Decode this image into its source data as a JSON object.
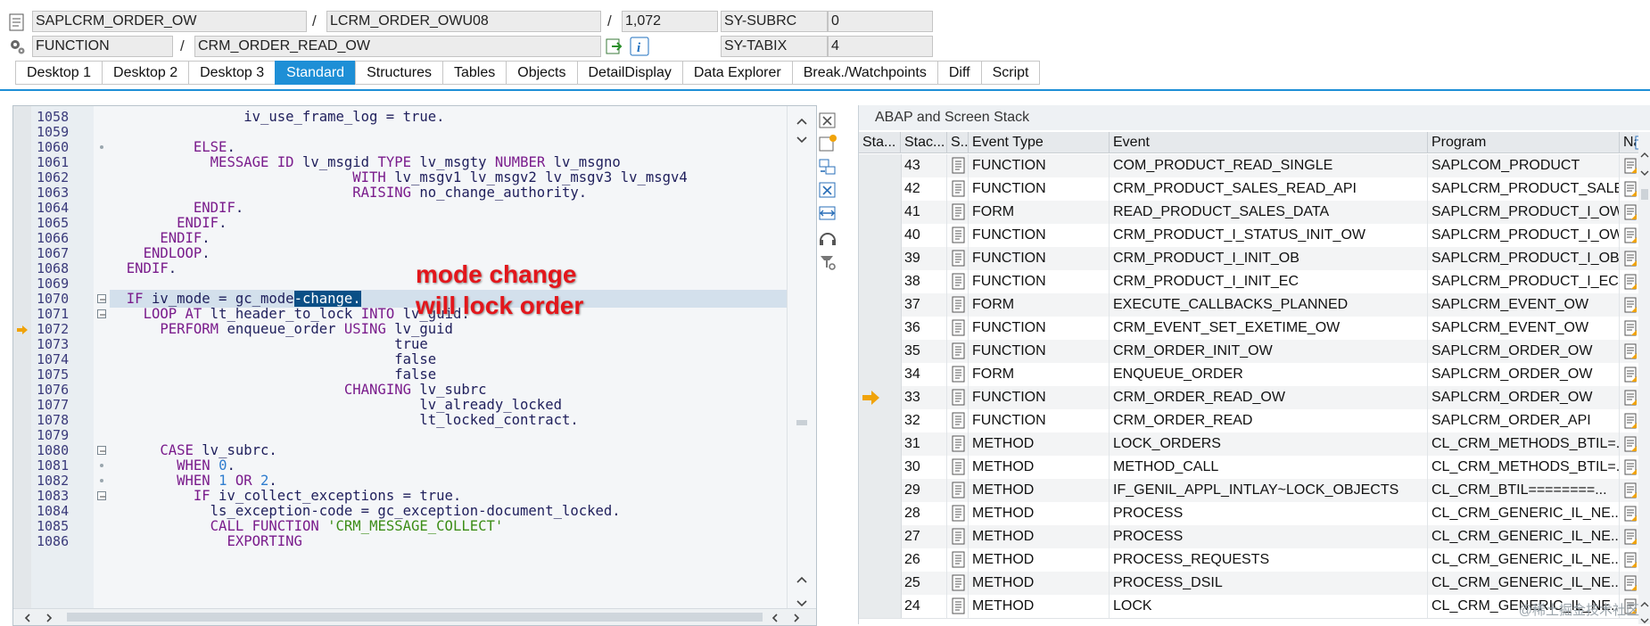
{
  "header": {
    "program": "SAPLCRM_ORDER_OW",
    "include": "LCRM_ORDER_OWU08",
    "line": "1,072",
    "event_type": "FUNCTION",
    "event_name": "CRM_ORDER_READ_OW",
    "sysvar1_name": "SY-SUBRC",
    "sysvar1_value": "0",
    "sysvar2_name": "SY-TABIX",
    "sysvar2_value": "4",
    "slash": "/"
  },
  "tabs": [
    {
      "label": "Desktop 1"
    },
    {
      "label": "Desktop 2"
    },
    {
      "label": "Desktop 3"
    },
    {
      "label": "Standard",
      "active": true
    },
    {
      "label": "Structures"
    },
    {
      "label": "Tables"
    },
    {
      "label": "Objects"
    },
    {
      "label": "DetailDisplay"
    },
    {
      "label": "Data Explorer"
    },
    {
      "label": "Break./Watchpoints"
    },
    {
      "label": "Diff"
    },
    {
      "label": "Script"
    }
  ],
  "annotation": {
    "line1": "mode change",
    "line2": "will lock order"
  },
  "code": {
    "current_line": "1072",
    "highlight_line": "1070",
    "lines": [
      {
        "n": "1058",
        "text": "                iv_use_frame_log = true."
      },
      {
        "n": "1059",
        "text": ""
      },
      {
        "n": "1060",
        "text": "          ELSE."
      },
      {
        "n": "1061",
        "text": "            MESSAGE ID lv_msgid TYPE lv_msgty NUMBER lv_msgno"
      },
      {
        "n": "1062",
        "text": "                             WITH lv_msgv1 lv_msgv2 lv_msgv3 lv_msgv4"
      },
      {
        "n": "1063",
        "text": "                             RAISING no_change_authority."
      },
      {
        "n": "1064",
        "text": "          ENDIF."
      },
      {
        "n": "1065",
        "text": "        ENDIF."
      },
      {
        "n": "1066",
        "text": "      ENDIF."
      },
      {
        "n": "1067",
        "text": "    ENDLOOP."
      },
      {
        "n": "1068",
        "text": "  ENDIF."
      },
      {
        "n": "1069",
        "text": ""
      },
      {
        "n": "1070",
        "text": "  IF iv_mode = gc_mode-change."
      },
      {
        "n": "1071",
        "text": "    LOOP AT lt_header_to_lock INTO lv_guid."
      },
      {
        "n": "1072",
        "text": "      PERFORM enqueue_order USING lv_guid"
      },
      {
        "n": "1073",
        "text": "                                  true"
      },
      {
        "n": "1074",
        "text": "                                  false"
      },
      {
        "n": "1075",
        "text": "                                  false"
      },
      {
        "n": "1076",
        "text": "                            CHANGING lv_subrc"
      },
      {
        "n": "1077",
        "text": "                                     lv_already_locked"
      },
      {
        "n": "1078",
        "text": "                                     lt_locked_contract."
      },
      {
        "n": "1079",
        "text": ""
      },
      {
        "n": "1080",
        "text": "      CASE lv_subrc."
      },
      {
        "n": "1081",
        "text": "        WHEN 0."
      },
      {
        "n": "1082",
        "text": "        WHEN 1 OR 2."
      },
      {
        "n": "1083",
        "text": "          IF iv_collect_exceptions = true."
      },
      {
        "n": "1084",
        "text": "            ls_exception-code = gc_exception-document_locked."
      },
      {
        "n": "1085",
        "text": "            CALL FUNCTION 'CRM_MESSAGE_COLLECT'"
      },
      {
        "n": "1086",
        "text": "              EXPORTING"
      }
    ]
  },
  "stack": {
    "title": "ABAP and Screen Stack",
    "columns": [
      "Sta...",
      "Stac...",
      "S..",
      "Event Type",
      "Event",
      "Program",
      "Na"
    ],
    "current_level": "33",
    "rows": [
      {
        "level": "43",
        "type": "FUNCTION",
        "event": "COM_PRODUCT_READ_SINGLE",
        "program": "SAPLCOM_PRODUCT"
      },
      {
        "level": "42",
        "type": "FUNCTION",
        "event": "CRM_PRODUCT_SALES_READ_API",
        "program": "SAPLCRM_PRODUCT_SALE..."
      },
      {
        "level": "41",
        "type": "FORM",
        "event": "READ_PRODUCT_SALES_DATA",
        "program": "SAPLCRM_PRODUCT_I_OW"
      },
      {
        "level": "40",
        "type": "FUNCTION",
        "event": "CRM_PRODUCT_I_STATUS_INIT_OW",
        "program": "SAPLCRM_PRODUCT_I_OW"
      },
      {
        "level": "39",
        "type": "FUNCTION",
        "event": "CRM_PRODUCT_I_INIT_OB",
        "program": "SAPLCRM_PRODUCT_I_OB"
      },
      {
        "level": "38",
        "type": "FUNCTION",
        "event": "CRM_PRODUCT_I_INIT_EC",
        "program": "SAPLCRM_PRODUCT_I_EC"
      },
      {
        "level": "37",
        "type": "FORM",
        "event": "EXECUTE_CALLBACKS_PLANNED",
        "program": "SAPLCRM_EVENT_OW"
      },
      {
        "level": "36",
        "type": "FUNCTION",
        "event": "CRM_EVENT_SET_EXETIME_OW",
        "program": "SAPLCRM_EVENT_OW"
      },
      {
        "level": "35",
        "type": "FUNCTION",
        "event": "CRM_ORDER_INIT_OW",
        "program": "SAPLCRM_ORDER_OW"
      },
      {
        "level": "34",
        "type": "FORM",
        "event": "ENQUEUE_ORDER",
        "program": "SAPLCRM_ORDER_OW"
      },
      {
        "level": "33",
        "type": "FUNCTION",
        "event": "CRM_ORDER_READ_OW",
        "program": "SAPLCRM_ORDER_OW"
      },
      {
        "level": "32",
        "type": "FUNCTION",
        "event": "CRM_ORDER_READ",
        "program": "SAPLCRM_ORDER_API"
      },
      {
        "level": "31",
        "type": "METHOD",
        "event": "LOCK_ORDERS",
        "program": "CL_CRM_METHODS_BTIL=..."
      },
      {
        "level": "30",
        "type": "METHOD",
        "event": "METHOD_CALL",
        "program": "CL_CRM_METHODS_BTIL=..."
      },
      {
        "level": "29",
        "type": "METHOD",
        "event": "IF_GENIL_APPL_INTLAY~LOCK_OBJECTS",
        "program": "CL_CRM_BTIL========..."
      },
      {
        "level": "28",
        "type": "METHOD",
        "event": "PROCESS",
        "program": "CL_CRM_GENERIC_IL_NE..."
      },
      {
        "level": "27",
        "type": "METHOD",
        "event": "PROCESS",
        "program": "CL_CRM_GENERIC_IL_NE..."
      },
      {
        "level": "26",
        "type": "METHOD",
        "event": "PROCESS_REQUESTS",
        "program": "CL_CRM_GENERIC_IL_NE..."
      },
      {
        "level": "25",
        "type": "METHOD",
        "event": "PROCESS_DSIL",
        "program": "CL_CRM_GENERIC_IL_NE..."
      },
      {
        "level": "24",
        "type": "METHOD",
        "event": "LOCK",
        "program": "CL_CRM_GENERIC_IL_NE..."
      }
    ]
  },
  "colors": {
    "accent": "#1e8fd6",
    "keyword": "#7a1c8c",
    "number": "#2f7dcf",
    "string": "#3c8d17",
    "annotation": "#e3161b",
    "arrow": "#f0a30a"
  },
  "watermark": "@稀土掘金技术社区"
}
